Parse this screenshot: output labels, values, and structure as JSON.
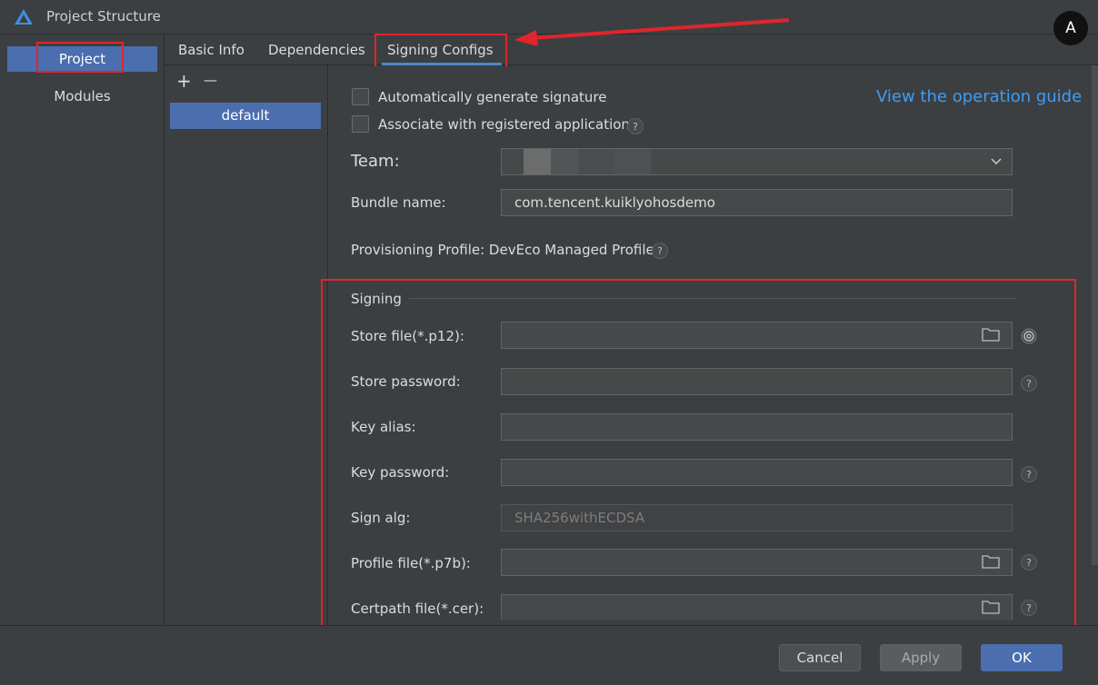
{
  "window": {
    "title": "Project Structure"
  },
  "nav": {
    "items": [
      {
        "label": "Project"
      },
      {
        "label": "Modules"
      }
    ]
  },
  "tabs": [
    {
      "label": "Basic Info"
    },
    {
      "label": "Dependencies"
    },
    {
      "label": "Signing Configs"
    }
  ],
  "configs": {
    "add_symbol": "+",
    "remove_symbol": "—",
    "items": [
      {
        "label": "default"
      }
    ]
  },
  "form": {
    "auto_sign_label": "Automatically generate signature",
    "associate_label": "Associate with registered application",
    "guide_link": "View the operation guide",
    "team_label": "Team:",
    "bundle_label": "Bundle name:",
    "bundle_value": "com.tencent.kuiklyohosdemo",
    "profile_label": "Provisioning Profile: DevEco Managed Profile",
    "signing_section": "Signing",
    "store_file_label": "Store file(*.p12):",
    "store_password_label": "Store password:",
    "key_alias_label": "Key alias:",
    "key_password_label": "Key password:",
    "sign_alg_label": "Sign alg:",
    "sign_alg_value": "SHA256withECDSA",
    "profile_file_label": "Profile file(*.p7b):",
    "certpath_label": "Certpath file(*.cer):",
    "help_glyph": "?"
  },
  "buttons": {
    "cancel": "Cancel",
    "apply": "Apply",
    "ok": "OK"
  },
  "colors": {
    "accent": "#4b6eaf",
    "link": "#3d9df5",
    "annotation": "#e0252c"
  },
  "overlay": {
    "translate_glyph": "A"
  }
}
